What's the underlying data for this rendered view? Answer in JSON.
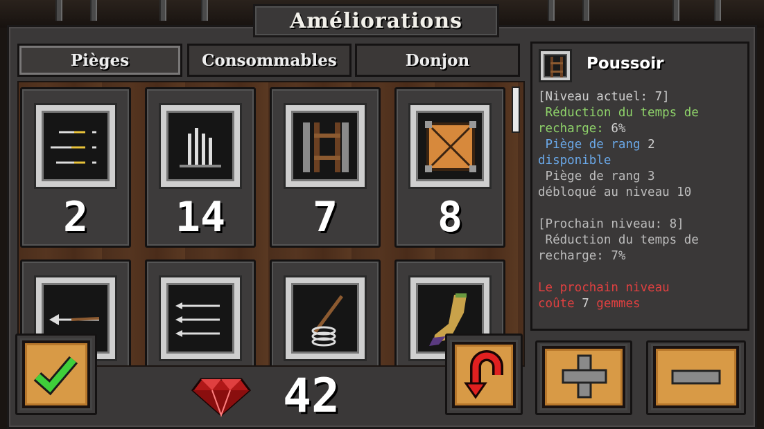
{
  "title": "Améliorations",
  "tabs": [
    {
      "label": "Pièges",
      "active": true
    },
    {
      "label": "Consommables",
      "active": false
    },
    {
      "label": "Donjon",
      "active": false
    }
  ],
  "traps": [
    {
      "icon": "arrow-lines-icon",
      "level": "2"
    },
    {
      "icon": "spikes-icon",
      "level": "14"
    },
    {
      "icon": "pusher-ladder-icon",
      "level": "7"
    },
    {
      "icon": "crate-icon",
      "level": "8"
    },
    {
      "icon": "arrow-launcher-icon",
      "level": ""
    },
    {
      "icon": "triple-arrow-icon",
      "level": ""
    },
    {
      "icon": "spring-trap-icon",
      "level": ""
    },
    {
      "icon": "boot-icon",
      "level": ""
    }
  ],
  "selected": {
    "name": "Poussoir",
    "icon": "pusher-ladder-icon",
    "current_level_header": "[Niveau actuel: 7]",
    "cooldown_current": " Réduction du temps de",
    "cooldown_current_2": "recharge: ",
    "cooldown_current_value": "6%",
    "rank2_a": " Piège de rang ",
    "rank2_num": "2",
    "rank2_b": "disponible",
    "rank3_a": " Piège de rang 3",
    "rank3_b": "débloqué au niveau 10",
    "next_level_header": "[Prochain niveau: 8]",
    "cooldown_next": " Réduction du temps de",
    "cooldown_next_2": "recharge: 7%",
    "cost_a": "Le prochain niveau",
    "cost_b": "coûte ",
    "cost_num": "7",
    "cost_c": " gemmes"
  },
  "gems": "42",
  "colors": {
    "green_text": "#8fd36a",
    "blue_text": "#6aa8e8",
    "red_text": "#e04040",
    "gray_text": "#d0d0d0",
    "button_orange": "#d89a46"
  }
}
